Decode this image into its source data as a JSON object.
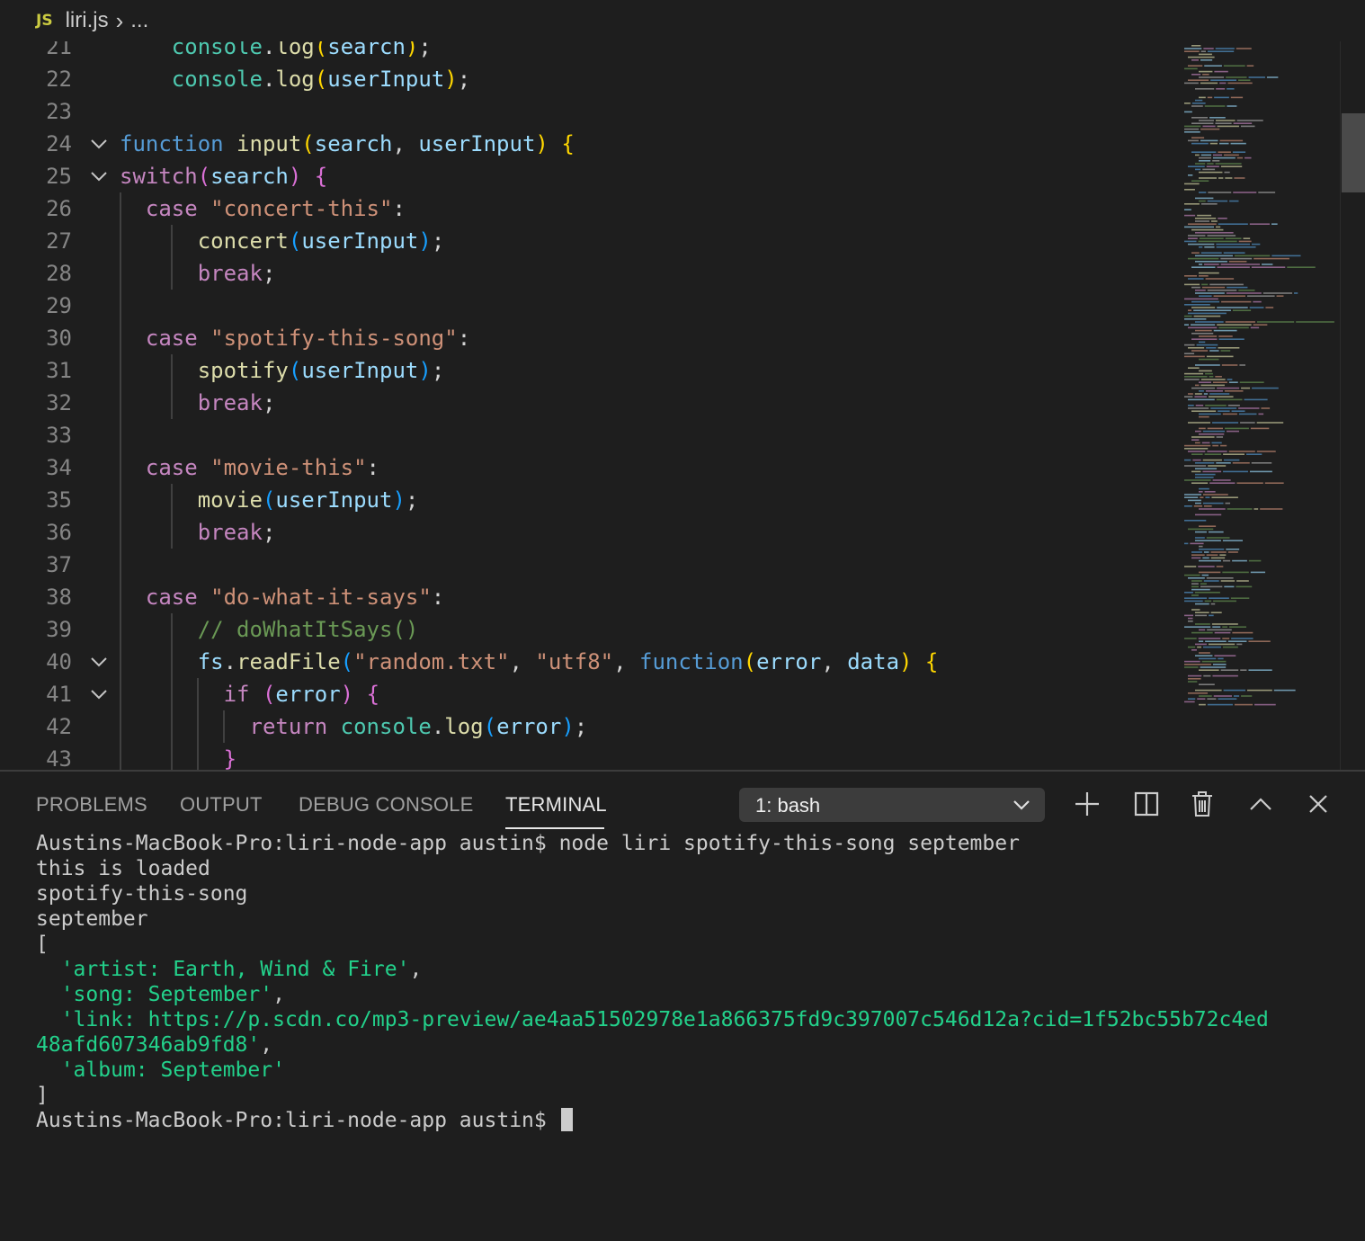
{
  "breadcrumb": {
    "file_badge": "JS",
    "file_name": "liri.js",
    "separator": "›",
    "more": "..."
  },
  "editor": {
    "lines": [
      {
        "n": "21",
        "code": [
          [
            "    ",
            ""
          ],
          [
            "console",
            "o"
          ],
          [
            ".",
            ""
          ],
          [
            "log",
            "f"
          ],
          [
            "(",
            "b1"
          ],
          [
            "search",
            "v"
          ],
          [
            ")",
            "b1"
          ],
          [
            ";",
            ""
          ]
        ]
      },
      {
        "n": "22",
        "code": [
          [
            "    ",
            ""
          ],
          [
            "console",
            "o"
          ],
          [
            ".",
            ""
          ],
          [
            "log",
            "f"
          ],
          [
            "(",
            "b1"
          ],
          [
            "userInput",
            "v"
          ],
          [
            ")",
            "b1"
          ],
          [
            ";",
            ""
          ]
        ]
      },
      {
        "n": "23",
        "code": []
      },
      {
        "n": "24",
        "fold": true,
        "code": [
          [
            "function",
            "k"
          ],
          [
            " ",
            ""
          ],
          [
            "input",
            "f"
          ],
          [
            "(",
            "b1"
          ],
          [
            "search",
            "v"
          ],
          [
            ", ",
            ""
          ],
          [
            "userInput",
            "v"
          ],
          [
            ")",
            "b1"
          ],
          [
            " ",
            ""
          ],
          [
            "{",
            "b1"
          ]
        ]
      },
      {
        "n": "25",
        "fold": true,
        "code": [
          [
            "switch",
            "c"
          ],
          [
            "(",
            "b2"
          ],
          [
            "search",
            "v"
          ],
          [
            ")",
            "b2"
          ],
          [
            " ",
            ""
          ],
          [
            "{",
            "b2"
          ]
        ]
      },
      {
        "n": "26",
        "code": [
          [
            "  ",
            ""
          ],
          [
            "case",
            "c"
          ],
          [
            " ",
            ""
          ],
          [
            "\"concert-this\"",
            "s"
          ],
          [
            ":",
            ""
          ]
        ]
      },
      {
        "n": "27",
        "code": [
          [
            "      ",
            ""
          ],
          [
            "concert",
            "f"
          ],
          [
            "(",
            "b3"
          ],
          [
            "userInput",
            "v"
          ],
          [
            ")",
            "b3"
          ],
          [
            ";",
            ""
          ]
        ]
      },
      {
        "n": "28",
        "code": [
          [
            "      ",
            ""
          ],
          [
            "break",
            "c"
          ],
          [
            ";",
            ""
          ]
        ]
      },
      {
        "n": "29",
        "code": []
      },
      {
        "n": "30",
        "code": [
          [
            "  ",
            ""
          ],
          [
            "case",
            "c"
          ],
          [
            " ",
            ""
          ],
          [
            "\"spotify-this-song\"",
            "s"
          ],
          [
            ":",
            ""
          ]
        ]
      },
      {
        "n": "31",
        "code": [
          [
            "      ",
            ""
          ],
          [
            "spotify",
            "f"
          ],
          [
            "(",
            "b3"
          ],
          [
            "userInput",
            "v"
          ],
          [
            ")",
            "b3"
          ],
          [
            ";",
            ""
          ]
        ]
      },
      {
        "n": "32",
        "code": [
          [
            "      ",
            ""
          ],
          [
            "break",
            "c"
          ],
          [
            ";",
            ""
          ]
        ]
      },
      {
        "n": "33",
        "code": []
      },
      {
        "n": "34",
        "code": [
          [
            "  ",
            ""
          ],
          [
            "case",
            "c"
          ],
          [
            " ",
            ""
          ],
          [
            "\"movie-this\"",
            "s"
          ],
          [
            ":",
            ""
          ]
        ]
      },
      {
        "n": "35",
        "code": [
          [
            "      ",
            ""
          ],
          [
            "movie",
            "f"
          ],
          [
            "(",
            "b3"
          ],
          [
            "userInput",
            "v"
          ],
          [
            ")",
            "b3"
          ],
          [
            ";",
            ""
          ]
        ]
      },
      {
        "n": "36",
        "code": [
          [
            "      ",
            ""
          ],
          [
            "break",
            "c"
          ],
          [
            ";",
            ""
          ]
        ]
      },
      {
        "n": "37",
        "code": []
      },
      {
        "n": "38",
        "code": [
          [
            "  ",
            ""
          ],
          [
            "case",
            "c"
          ],
          [
            " ",
            ""
          ],
          [
            "\"do-what-it-says\"",
            "s"
          ],
          [
            ":",
            ""
          ]
        ]
      },
      {
        "n": "39",
        "code": [
          [
            "      ",
            ""
          ],
          [
            "// doWhatItSays()",
            "cm"
          ]
        ]
      },
      {
        "n": "40",
        "fold": true,
        "code": [
          [
            "      ",
            ""
          ],
          [
            "fs",
            "v"
          ],
          [
            ".",
            ""
          ],
          [
            "readFile",
            "f"
          ],
          [
            "(",
            "b3"
          ],
          [
            "\"random.txt\"",
            "s"
          ],
          [
            ", ",
            ""
          ],
          [
            "\"utf8\"",
            "s"
          ],
          [
            ", ",
            ""
          ],
          [
            "function",
            "k"
          ],
          [
            "(",
            "b1"
          ],
          [
            "error",
            "v"
          ],
          [
            ", ",
            ""
          ],
          [
            "data",
            "v"
          ],
          [
            ")",
            "b1"
          ],
          [
            " ",
            ""
          ],
          [
            "{",
            "b1"
          ]
        ]
      },
      {
        "n": "41",
        "fold": true,
        "code": [
          [
            "        ",
            ""
          ],
          [
            "if",
            "c"
          ],
          [
            " ",
            ""
          ],
          [
            "(",
            "b2"
          ],
          [
            "error",
            "v"
          ],
          [
            ")",
            "b2"
          ],
          [
            " ",
            ""
          ],
          [
            "{",
            "b2"
          ]
        ]
      },
      {
        "n": "42",
        "code": [
          [
            "          ",
            ""
          ],
          [
            "return",
            "c"
          ],
          [
            " ",
            ""
          ],
          [
            "console",
            "o"
          ],
          [
            ".",
            ""
          ],
          [
            "log",
            "f"
          ],
          [
            "(",
            "b3"
          ],
          [
            "error",
            "v"
          ],
          [
            ")",
            "b3"
          ],
          [
            ";",
            ""
          ]
        ]
      },
      {
        "n": "43",
        "code": [
          [
            "        ",
            ""
          ],
          [
            "}",
            "b2"
          ]
        ]
      }
    ]
  },
  "panel": {
    "tabs": [
      "PROBLEMS",
      "OUTPUT",
      "DEBUG CONSOLE",
      "TERMINAL"
    ],
    "active_tab": "TERMINAL",
    "shell_select": "1: bash",
    "actions": {
      "new": "plus-icon",
      "split": "split-icon",
      "kill": "trash-icon",
      "maximize": "chevron-up-icon",
      "close": "close-icon"
    }
  },
  "terminal": {
    "lines": [
      {
        "text": "Austins-MacBook-Pro:liri-node-app austin$ node liri spotify-this-song september",
        "color": "default"
      },
      {
        "text": "this is loaded",
        "color": "default"
      },
      {
        "text": "spotify-this-song",
        "color": "default"
      },
      {
        "text": "september",
        "color": "default"
      },
      {
        "text": "[",
        "color": "default"
      },
      {
        "parts": [
          [
            "  ",
            "default"
          ],
          [
            "'artist: Earth, Wind & Fire'",
            "green"
          ],
          [
            ",",
            "default"
          ]
        ]
      },
      {
        "parts": [
          [
            "  ",
            "default"
          ],
          [
            "'song: September'",
            "green"
          ],
          [
            ",",
            "default"
          ]
        ]
      },
      {
        "parts": [
          [
            "  ",
            "default"
          ],
          [
            "'link: https://p.scdn.co/mp3-preview/ae4aa51502978e1a866375fd9c397007c546d12a?cid=1f52bc55b72c4ed",
            "green"
          ]
        ]
      },
      {
        "parts": [
          [
            "48afd607346ab9fd8'",
            "green"
          ],
          [
            ",",
            "default"
          ]
        ]
      },
      {
        "parts": [
          [
            "  ",
            "default"
          ],
          [
            "'album: September'",
            "green"
          ]
        ]
      },
      {
        "text": "]",
        "color": "default"
      }
    ],
    "prompt": "Austins-MacBook-Pro:liri-node-app austin$ "
  },
  "colors": {
    "background": "#1e1e1e",
    "terminal_green": "#23d18b",
    "panel_border": "#3c3c3c"
  }
}
